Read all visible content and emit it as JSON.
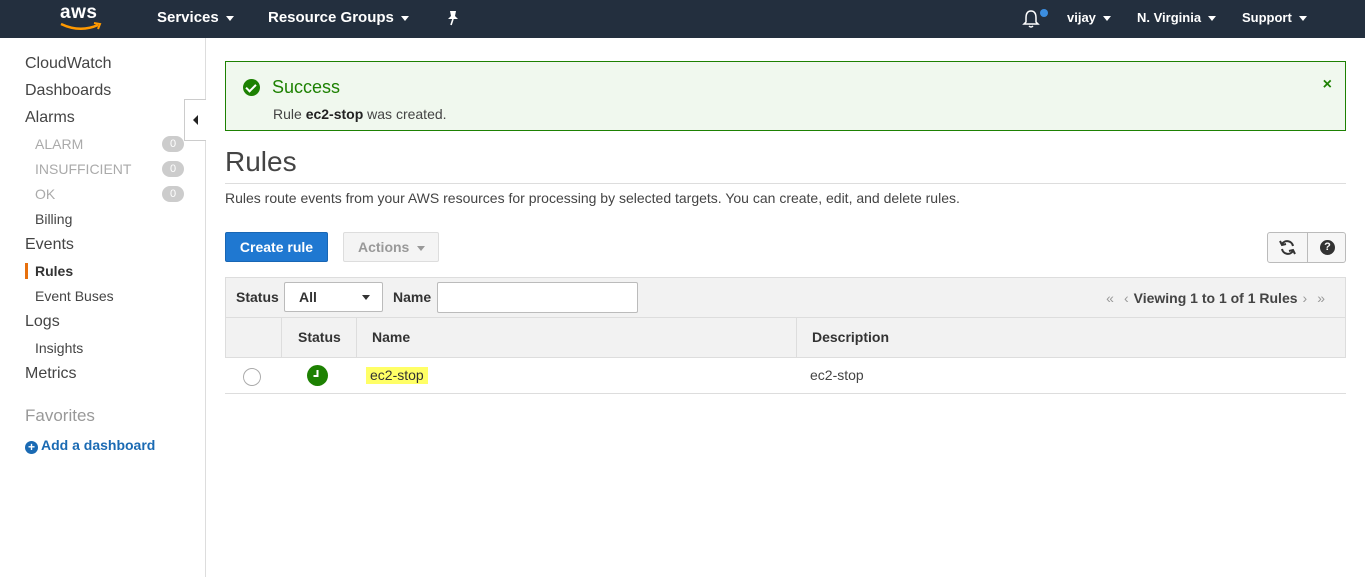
{
  "topnav": {
    "logo_text": "aws",
    "services": "Services",
    "resource_groups": "Resource Groups",
    "user": "vijay",
    "region": "N. Virginia",
    "support": "Support",
    "brand_color": "#232f3e",
    "pin_icon": "pin-icon",
    "bell_icon": "bell-icon"
  },
  "sidebar": {
    "cloudwatch": "CloudWatch",
    "dashboards": "Dashboards",
    "alarms": "Alarms",
    "alarm_states": [
      {
        "label": "ALARM",
        "count": "0"
      },
      {
        "label": "INSUFFICIENT",
        "count": "0"
      },
      {
        "label": "OK",
        "count": "0"
      }
    ],
    "billing": "Billing",
    "events": "Events",
    "rules": "Rules",
    "event_buses": "Event Buses",
    "logs": "Logs",
    "insights": "Insights",
    "metrics": "Metrics",
    "favorites": "Favorites",
    "add_dashboard": "Add a dashboard",
    "active_color": "#e7700d"
  },
  "flash": {
    "title": "Success",
    "msg_prefix": "Rule ",
    "rule_name": "ec2-stop",
    "msg_suffix": " was created.",
    "close": "×",
    "color": "#1d8102"
  },
  "page": {
    "title": "Rules",
    "description": "Rules route events from your AWS resources for processing by selected targets. You can create, edit, and delete rules.",
    "create_rule": "Create rule",
    "actions": "Actions",
    "refresh_icon": "refresh-icon",
    "help": "?"
  },
  "filter": {
    "status_label": "Status",
    "status_value": "All",
    "name_label": "Name",
    "name_value": "",
    "pager_text": "Viewing 1 to 1 of 1 Rules"
  },
  "table": {
    "columns": [
      "Status",
      "Name",
      "Description"
    ],
    "rows": [
      {
        "status": "enabled",
        "name": "ec2-stop",
        "description": "ec2-stop"
      }
    ]
  }
}
